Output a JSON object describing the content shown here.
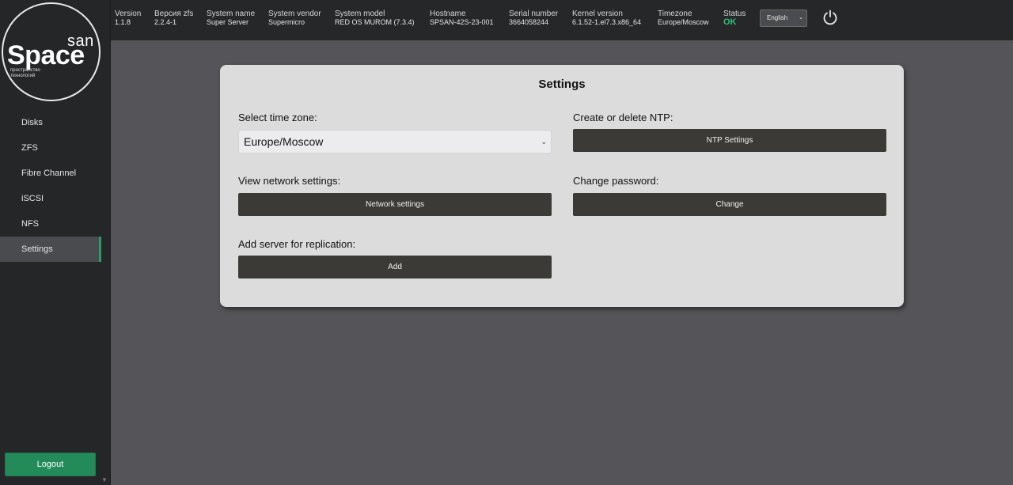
{
  "logo": {
    "san": "san",
    "space": "Space",
    "subtitle": "пространство технологий"
  },
  "sidebar": {
    "items": [
      {
        "label": "Disks",
        "active": false
      },
      {
        "label": "ZFS",
        "active": false
      },
      {
        "label": "Fibre Channel",
        "active": false
      },
      {
        "label": "iSCSI",
        "active": false
      },
      {
        "label": "NFS",
        "active": false
      },
      {
        "label": "Settings",
        "active": true
      }
    ],
    "logout_label": "Logout"
  },
  "header": {
    "fields": [
      {
        "label": "Version",
        "value": "1.1.8"
      },
      {
        "label": "Версия zfs",
        "value": "2.2.4-1"
      },
      {
        "label": "System name",
        "value": "Super Server"
      },
      {
        "label": "System vendor",
        "value": "Supermicro"
      },
      {
        "label": "System model",
        "value": "RED OS MUROM (7.3.4)"
      },
      {
        "label": "Hostname",
        "value": "SPSAN-42S-23-001"
      },
      {
        "label": "Serial number",
        "value": "3664058244"
      },
      {
        "label": "Kernel version",
        "value": "6.1.52-1.el7.3.x86_64"
      },
      {
        "label": "Timezone",
        "value": "Europe/Moscow"
      },
      {
        "label": "Status",
        "value": "OK"
      }
    ],
    "language": "English",
    "power_icon": "power-icon"
  },
  "settings": {
    "title": "Settings",
    "timezone_label": "Select time zone:",
    "timezone_value": "Europe/Moscow",
    "ntp_label": "Create or delete NTP:",
    "ntp_button": "NTP Settings",
    "network_label": "View network settings:",
    "network_button": "Network settings",
    "password_label": "Change password:",
    "password_button": "Change",
    "replication_label": "Add server for replication:",
    "replication_button": "Add"
  },
  "colors": {
    "accent": "#238a5a",
    "status_ok": "#2fbf7a",
    "button_dark": "#3c3a36",
    "background": "#545459",
    "sidebar": "#252628",
    "card": "#dcdcdc"
  }
}
